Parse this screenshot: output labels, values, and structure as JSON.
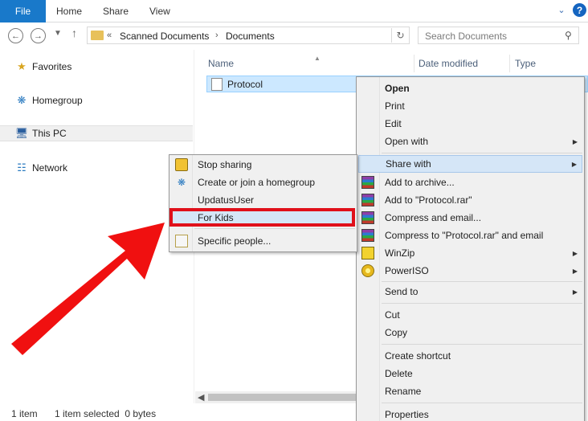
{
  "ribbon": {
    "tabs": [
      "File",
      "Home",
      "Share",
      "View"
    ]
  },
  "address": {
    "overflow": "«",
    "crumbs": [
      "Scanned Documents",
      "Documents"
    ],
    "separator": "›"
  },
  "search": {
    "placeholder": "Search Documents"
  },
  "navpane": {
    "items": [
      "Favorites",
      "Homegroup",
      "This PC",
      "Network"
    ]
  },
  "columns": [
    "Name",
    "Date modified",
    "Type"
  ],
  "file": {
    "name": "Protocol"
  },
  "status": {
    "count": "1 item",
    "selected": "1 item selected  0 bytes"
  },
  "context_menu": {
    "items": [
      "Open",
      "Print",
      "Edit",
      "Open with",
      "Share with",
      "Add to archive...",
      "Add to \"Protocol.rar\"",
      "Compress and email...",
      "Compress to \"Protocol.rar\" and email",
      "WinZip",
      "PowerISO",
      "Send to",
      "Cut",
      "Copy",
      "Create shortcut",
      "Delete",
      "Rename",
      "Properties"
    ]
  },
  "share_submenu": {
    "items": [
      "Stop sharing",
      "Create or join a homegroup",
      "UpdatusUser",
      "For Kids",
      "Specific people..."
    ]
  },
  "colors": {
    "file_tab": "#1979ca",
    "highlight": "#e0101a",
    "selection": "#cce8ff"
  }
}
